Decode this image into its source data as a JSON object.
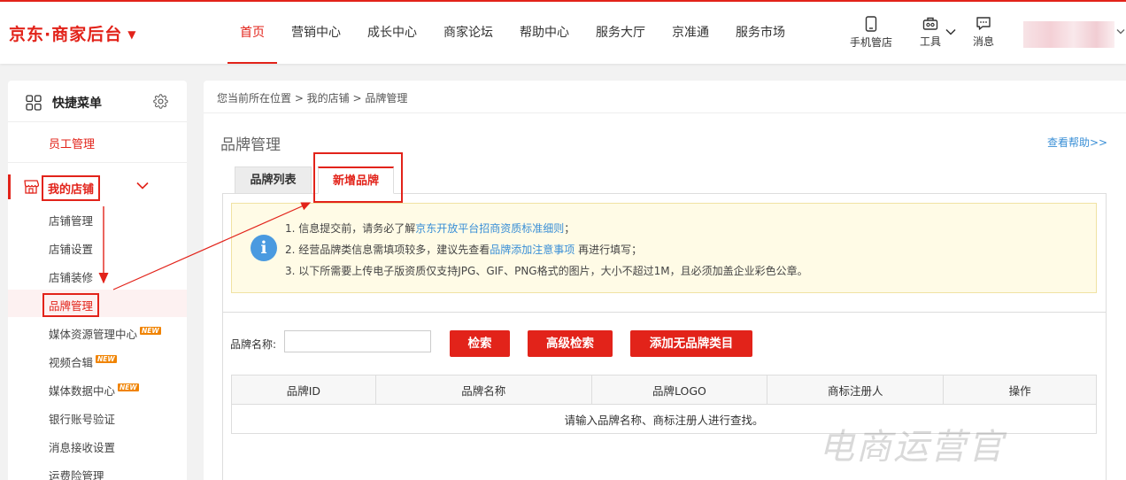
{
  "header": {
    "logo": "京东·商家后台",
    "nav": [
      "首页",
      "营销中心",
      "成长中心",
      "商家论坛",
      "帮助中心",
      "服务大厅",
      "京准通",
      "服务市场"
    ],
    "active_nav": "首页",
    "tools": {
      "phone": "手机管店",
      "tools": "工具",
      "messages": "消息"
    }
  },
  "sidebar": {
    "quick_menu": "快捷菜单",
    "staff": "员工管理",
    "store_section": "我的店铺",
    "items": [
      {
        "label": "店铺管理"
      },
      {
        "label": "店铺设置"
      },
      {
        "label": "店铺装修"
      },
      {
        "label": "品牌管理",
        "active": true
      },
      {
        "label": "媒体资源管理中心",
        "badge": "NEW"
      },
      {
        "label": "视频合辑",
        "badge": "NEW"
      },
      {
        "label": "媒体数据中心",
        "badge": "NEW"
      },
      {
        "label": "银行账号验证"
      },
      {
        "label": "消息接收设置"
      },
      {
        "label": "运费险管理"
      }
    ]
  },
  "main": {
    "breadcrumb": "您当前所在位置 > 我的店铺 > 品牌管理",
    "title": "品牌管理",
    "help": "查看帮助>>",
    "tabs": [
      "品牌列表",
      "新增品牌"
    ],
    "active_tab": "新增品牌",
    "notice": {
      "line1_prefix": "1. 信息提交前，请务必了解",
      "line1_link": "京东开放平台招商资质标准细则",
      "line1_suffix": "；",
      "line2_prefix": "2. 经营品牌类信息需填项较多，建议先查看",
      "line2_link": "品牌添加注意事项",
      "line2_suffix": " 再进行填写；",
      "line3": "3. 以下所需要上传电子版资质仅支持JPG、GIF、PNG格式的图片，大小不超过1M，且必须加盖企业彩色公章。"
    },
    "search": {
      "label": "品牌名称:",
      "value": "",
      "btn_search": "检索",
      "btn_advanced": "高级检索",
      "btn_add": "添加无品牌类目"
    },
    "table": {
      "columns": [
        "品牌ID",
        "品牌名称",
        "品牌LOGO",
        "商标注册人",
        "操作"
      ],
      "empty_text": "请输入品牌名称、商标注册人进行查找。"
    }
  },
  "watermark": "电商运营官",
  "colors": {
    "brand_red": "#e2231a",
    "link_blue": "#3a8fd6",
    "notice_bg": "#fffbe6"
  }
}
